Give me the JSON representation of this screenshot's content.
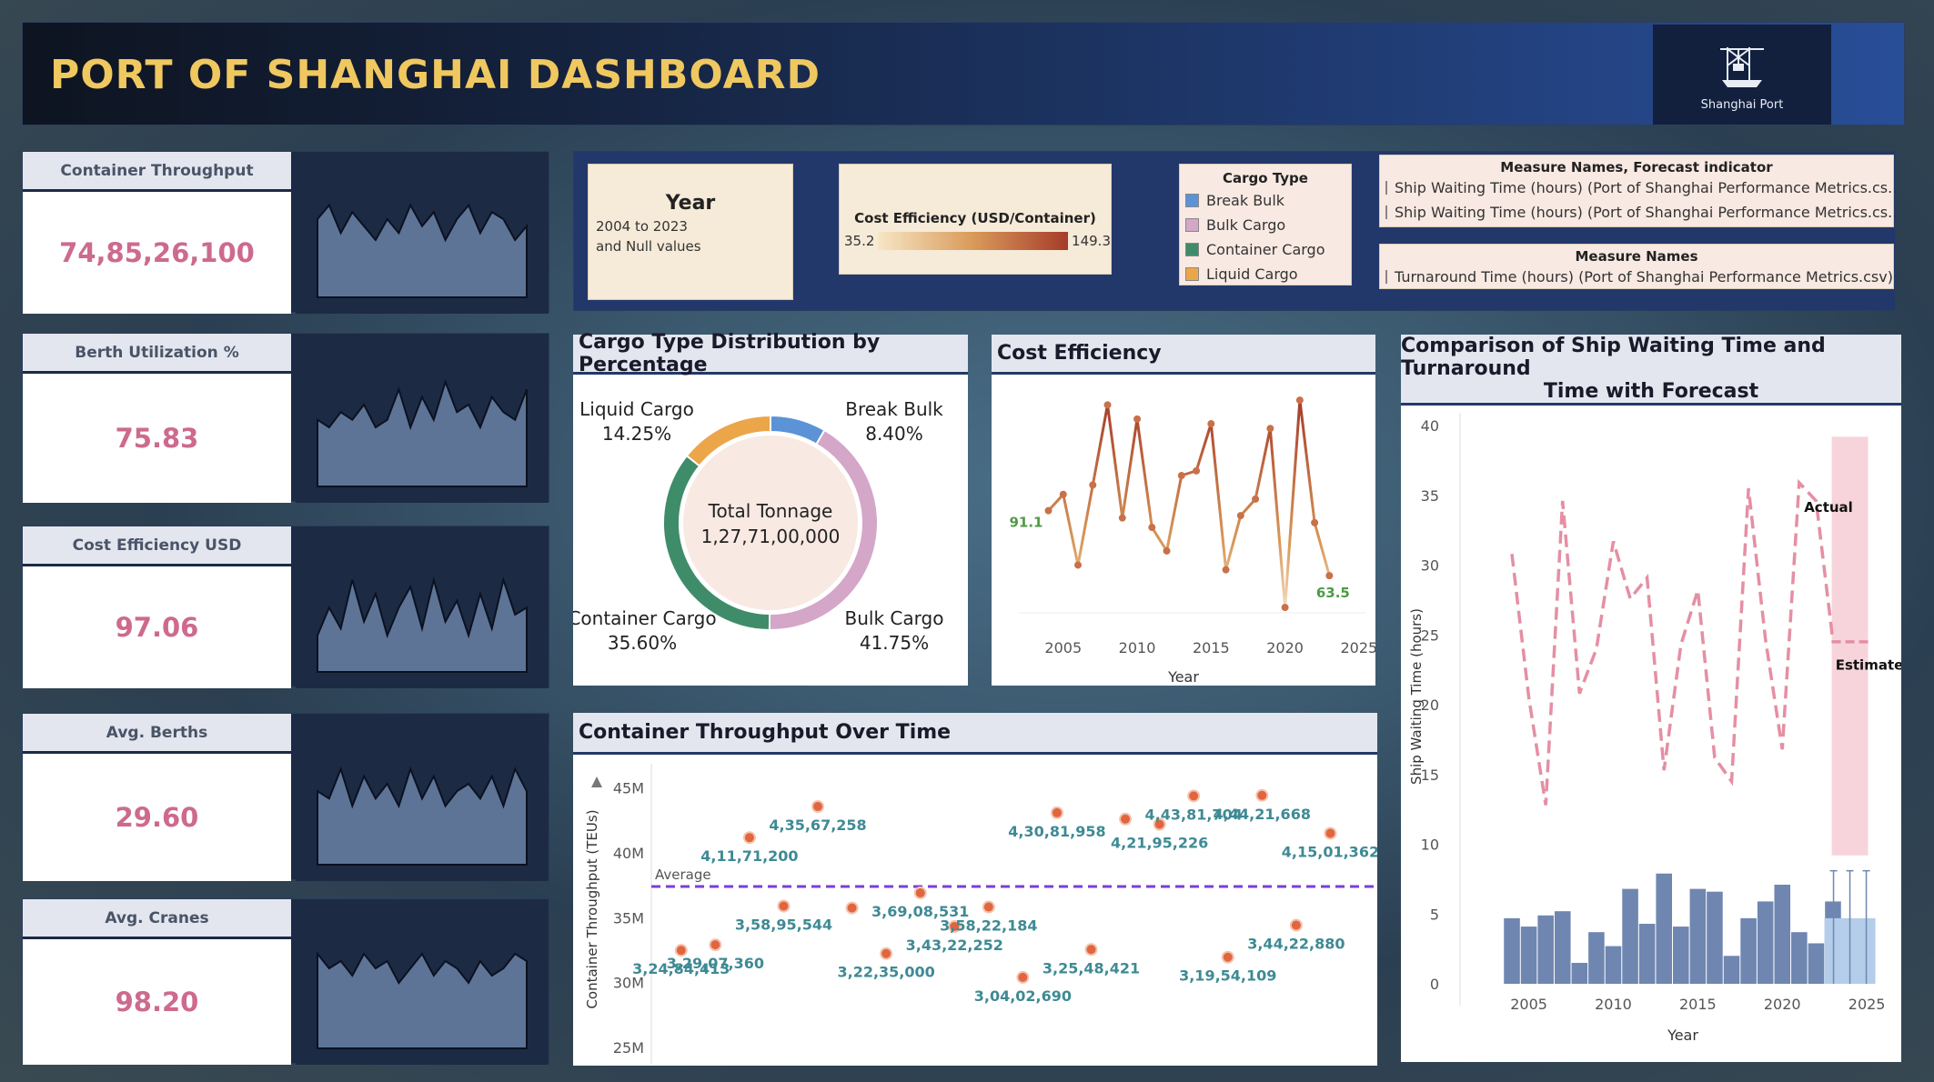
{
  "header": {
    "title": "PORT OF SHANGHAI DASHBOARD",
    "logo_text": "Shanghai Port"
  },
  "kpis": [
    {
      "label": "Container Throughput",
      "value": "74,85,26,100"
    },
    {
      "label": "Berth Utilization %",
      "value": "75.83"
    },
    {
      "label": "Cost Efficiency USD",
      "value": "97.06"
    },
    {
      "label": "Avg. Berths",
      "value": "29.60"
    },
    {
      "label": "Avg. Cranes",
      "value": "98.20"
    }
  ],
  "filters": {
    "year_title": "Year",
    "year_value_line1": "2004 to 2023",
    "year_value_line2": "and Null values",
    "cost_title": "Cost Efficiency (USD/Container)",
    "cost_min": "35.2",
    "cost_max": "149.3",
    "cargo_title": "Cargo Type",
    "cargo_items": [
      {
        "label": "Break Bulk",
        "color": "#5b93d6"
      },
      {
        "label": "Bulk Cargo",
        "color": "#d4a6c8"
      },
      {
        "label": "Container Cargo",
        "color": "#3f8c6a"
      },
      {
        "label": "Liquid Cargo",
        "color": "#eba64a"
      }
    ],
    "measure_forecast_title": "Measure Names, Forecast indicator",
    "measure_forecast_items": [
      {
        "label": "Ship Waiting Time (hours) (Port of Shanghai Performance Metrics.cs..",
        "color": "#6f86b0"
      },
      {
        "label": "Ship Waiting Time (hours) (Port of Shanghai Performance Metrics.cs..",
        "color": "#b4cdea"
      }
    ],
    "measure_title": "Measure Names",
    "measure_items": [
      {
        "label": "Turnaround Time (hours) (Port of Shanghai Performance Metrics.csv)",
        "color": "#f1a6b6"
      }
    ]
  },
  "donut": {
    "title": "Cargo Type Distribution by Percentage",
    "center_line1": "Total Tonnage",
    "center_line2": "1,27,71,00,000",
    "slices": [
      {
        "name": "Break Bulk",
        "pct": "8.40%",
        "value": 8.4,
        "color": "#5b93d6"
      },
      {
        "name": "Bulk Cargo",
        "pct": "41.75%",
        "value": 41.75,
        "color": "#d4a6c8"
      },
      {
        "name": "Container Cargo",
        "pct": "35.60%",
        "value": 35.6,
        "color": "#3f8c6a"
      },
      {
        "name": "Liquid Cargo",
        "pct": "14.25%",
        "value": 14.25,
        "color": "#eba64a"
      }
    ]
  },
  "cost_chart": {
    "title": "Cost Efficiency",
    "xlabel": "Year",
    "start_label": "91.1",
    "end_label": "63.5",
    "ticks": [
      "2005",
      "2010",
      "2015",
      "2020",
      "2025"
    ]
  },
  "throughput_chart": {
    "title": "Container Throughput Over Time",
    "ylabel": "Container Throughput (TEUs)",
    "average_label": "Average",
    "yticks": [
      "25M",
      "30M",
      "35M",
      "40M",
      "45M"
    ]
  },
  "comparison_chart": {
    "title_line1": "Comparison of Ship Waiting Time and Turnaround",
    "title_line2": "Time with Forecast",
    "ylabel": "Ship Waiting Time (hours)",
    "xlabel": "Year",
    "actual_label": "Actual",
    "estimate_label": "Estimate",
    "yticks": [
      "0",
      "5",
      "10",
      "15",
      "20",
      "25",
      "30",
      "35",
      "40"
    ],
    "xticks": [
      "2005",
      "2010",
      "2015",
      "2020",
      "2025"
    ]
  },
  "chart_data": [
    {
      "type": "line",
      "title": "Cost Efficiency",
      "xlabel": "Year",
      "x": [
        2004,
        2005,
        2006,
        2007,
        2008,
        2009,
        2010,
        2011,
        2012,
        2013,
        2014,
        2015,
        2016,
        2017,
        2018,
        2019,
        2020,
        2021,
        2022,
        2023
      ],
      "values": [
        91.1,
        98,
        68,
        102,
        136,
        88,
        130,
        84,
        74,
        106,
        108,
        128,
        66,
        89,
        96,
        126,
        50,
        138,
        86,
        63.5
      ],
      "ylim": [
        40,
        145
      ]
    },
    {
      "type": "scatter",
      "title": "Container Throughput Over Time",
      "ylabel": "Container Throughput (TEUs)",
      "ylim": [
        25000000,
        47000000
      ],
      "points": [
        {
          "x": 2004,
          "y": 32484413,
          "label": "3,24,84,413"
        },
        {
          "x": 2005,
          "y": 32907360,
          "label": "3,29,07,360"
        },
        {
          "x": 2006,
          "y": 41171200,
          "label": "4,11,71,200"
        },
        {
          "x": 2007,
          "y": 35895544,
          "label": "3,58,95,544"
        },
        {
          "x": 2008,
          "y": 43567258,
          "label": "4,35,67,258"
        },
        {
          "x": 2009,
          "y": 35750000,
          "label": ""
        },
        {
          "x": 2010,
          "y": 32235000,
          "label": "3,22,35,000"
        },
        {
          "x": 2011,
          "y": 36908531,
          "label": "3,69,08,531"
        },
        {
          "x": 2012,
          "y": 34322252,
          "label": "3,43,22,252"
        },
        {
          "x": 2013,
          "y": 35822184,
          "label": "3,58,22,184"
        },
        {
          "x": 2014,
          "y": 30402690,
          "label": "3,04,02,690"
        },
        {
          "x": 2015,
          "y": 43081958,
          "label": "4,30,81,958"
        },
        {
          "x": 2016,
          "y": 32548421,
          "label": "3,25,48,421"
        },
        {
          "x": 2017,
          "y": 42600000,
          "label": ""
        },
        {
          "x": 2018,
          "y": 42195226,
          "label": "4,21,95,226"
        },
        {
          "x": 2019,
          "y": 44381704,
          "label": "4,43,81,704"
        },
        {
          "x": 2020,
          "y": 31954109,
          "label": "3,19,54,109"
        },
        {
          "x": 2021,
          "y": 44421668,
          "label": "4,44,21,668"
        },
        {
          "x": 2022,
          "y": 34422880,
          "label": "3,44,22,880"
        },
        {
          "x": 2023,
          "y": 41501362,
          "label": "4,15,01,362"
        }
      ],
      "average": 37400000
    },
    {
      "type": "bar",
      "title": "Comparison of Ship Waiting Time and Turnaround Time with Forecast",
      "series": [
        {
          "name": "Ship Waiting Time (hours)",
          "x": [
            2004,
            2005,
            2006,
            2007,
            2008,
            2009,
            2010,
            2011,
            2012,
            2013,
            2014,
            2015,
            2016,
            2017,
            2018,
            2019,
            2020,
            2021,
            2022,
            2023
          ],
          "values": [
            4.7,
            4.1,
            4.9,
            5.2,
            1.5,
            3.7,
            2.7,
            6.8,
            4.3,
            7.9,
            4.1,
            6.8,
            6.6,
            2.0,
            4.7,
            5.9,
            7.1,
            3.7,
            2.9,
            5.9
          ]
        },
        {
          "name": "Turnaround Time (hours)",
          "x": [
            2004,
            2005,
            2006,
            2007,
            2008,
            2009,
            2010,
            2011,
            2012,
            2013,
            2014,
            2015,
            2016,
            2017,
            2018,
            2019,
            2020,
            2021,
            2022,
            2023,
            2024
          ],
          "values": [
            30.8,
            20.5,
            12.8,
            34.6,
            20.8,
            24.0,
            31.7,
            27.6,
            29.1,
            15.3,
            24.3,
            28.2,
            16.2,
            14.5,
            35.5,
            24.7,
            16.8,
            35.9,
            34.6,
            24.5,
            24.5
          ]
        },
        {
          "name": "Ship Waiting Time (hours) Estimate",
          "x": [
            2024
          ],
          "values": [
            4.7
          ]
        }
      ],
      "ylim": [
        0,
        40
      ]
    }
  ]
}
